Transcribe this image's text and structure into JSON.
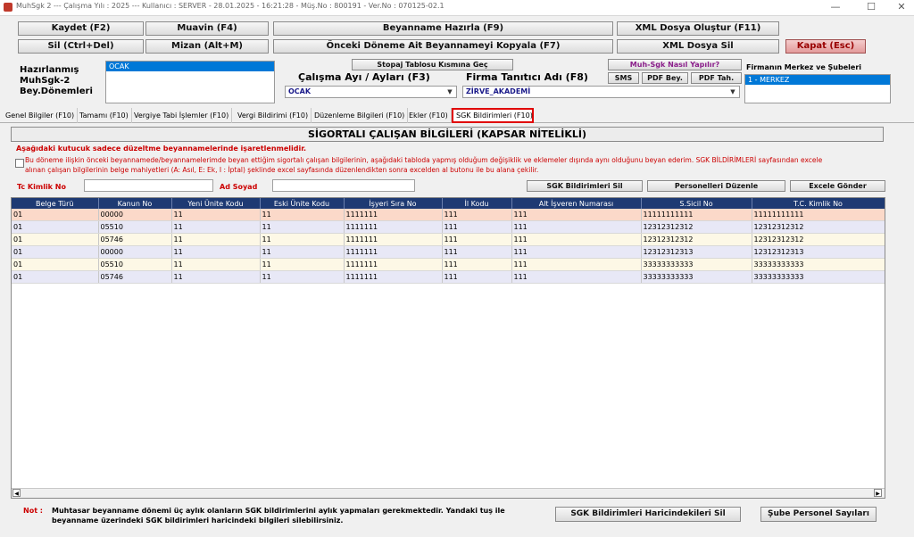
{
  "window": {
    "title": "MuhSgk 2  ---  Çalışma Yılı : 2025  ---  Kullanıcı : SERVER  -  28.01.2025  -  16:21:28  -  Müş.No : 800191  -  Ver.No : 070125-02.1",
    "minimize": "—",
    "maximize": "☐",
    "close": "✕"
  },
  "toolbar": {
    "kaydet": "Kaydet (F2)",
    "muavin": "Muavin (F4)",
    "beyanname_hazirla": "Beyanname Hazırla (F9)",
    "xml_olustur": "XML Dosya Oluştur (F11)",
    "sil": "Sil (Ctrl+Del)",
    "mizan": "Mizan (Alt+M)",
    "onceki_kopyala": "Önceki Döneme Ait Beyannameyi Kopyala (F7)",
    "xml_sil": "XML Dosya Sil",
    "kapat": "Kapat (Esc)"
  },
  "left_labels": [
    "Hazırlanmış",
    "MuhSgk-2",
    "Bey.Dönemleri"
  ],
  "donemler_list": [
    "OCAK"
  ],
  "stopaj_button": "Stopaj Tablosu Kısmına Geç",
  "calisma_label": "Çalışma Ayı / Ayları (F3)",
  "calisma_value": "OCAK",
  "firma_label": "Firma Tanıtıcı Adı (F8)",
  "firma_value": "ZİRVE_AKADEMİ",
  "nasil_button": "Muh-Sgk Nasıl Yapılır?",
  "sms_button": "SMS",
  "pdf_bey_button": "PDF Bey.",
  "pdf_tah_button": "PDF Tah.",
  "subeler_label": "Firmanın Merkez ve Şubeleri",
  "subeler_list": [
    "1 - MERKEZ"
  ],
  "tabs": [
    "Genel Bilgiler (F10)",
    "Tamamı (F10)",
    "Vergiye Tabi İşlemler (F10)",
    "Vergi Bildirimi (F10)",
    "Düzenleme Bilgileri (F10)",
    "Ekler (F10)",
    "SGK Bildirimleri (F10)"
  ],
  "section_title": "SİGORTALI ÇALIŞAN BİLGİLERİ (KAPSAR NİTELİKLİ)",
  "warning_heading": "Aşağıdaki kutucuk sadece düzeltme beyannamelerinde işaretlenmelidir.",
  "warning_line1": "Bu döneme ilişkin önceki beyannamede/beyannamelerimde beyan ettiğim sigortalı çalışan bilgilerinin, aşağıdaki tabloda yapmış olduğum değişiklik ve eklemeler dışında aynı olduğunu beyan ederim. SGK BİLDİRİMLERİ sayfasından excele",
  "warning_line2": "alınan çalışan bilgilerinin belge mahiyetleri (A: Asıl, E: Ek, I : İptal) şeklinde excel sayfasında düzenlendikten sonra excelden al butonu ile bu alana çekilir.",
  "tc_label": "Tc Kimlik No",
  "ad_label": "Ad Soyad",
  "sgk_sil_button": "SGK Bildirimleri Sil",
  "personel_duzenle_button": "Personelleri Düzenle",
  "excele_gonder_button": "Excele Gönder",
  "table": {
    "headers": [
      "Belge Türü",
      "Kanun No",
      "Yeni Ünite Kodu",
      "Eski Ünite Kodu",
      "İşyeri Sıra No",
      "İl Kodu",
      "Alt İşveren Numarası",
      "S.Sicil No",
      "T.C. Kimlik No"
    ],
    "rows": [
      [
        "01",
        "00000",
        "11",
        "11",
        "1111111",
        "111",
        "111",
        "11111111111",
        "11111111111"
      ],
      [
        "01",
        "05510",
        "11",
        "11",
        "1111111",
        "111",
        "111",
        "12312312312",
        "12312312312"
      ],
      [
        "01",
        "05746",
        "11",
        "11",
        "1111111",
        "111",
        "111",
        "12312312312",
        "12312312312"
      ],
      [
        "01",
        "00000",
        "11",
        "11",
        "1111111",
        "111",
        "111",
        "12312312313",
        "12312312313"
      ],
      [
        "01",
        "05510",
        "11",
        "11",
        "1111111",
        "111",
        "111",
        "33333333333",
        "33333333333"
      ],
      [
        "01",
        "05746",
        "11",
        "11",
        "1111111",
        "111",
        "111",
        "33333333333",
        "33333333333"
      ]
    ]
  },
  "note_label": "Not :",
  "note_line1": "Muhtasar beyanname dönemi üç aylık olanların SGK bildirimlerini aylık yapmaları gerekmektedir. Yandaki tuş ile",
  "note_line2": "beyanname üzerindeki SGK bildirimleri haricindeki bilgileri silebilirsiniz.",
  "haric_sil_button": "SGK Bildirimleri Haricindekileri Sil",
  "sube_personel_button": "Şube Personel Sayıları",
  "colors": {
    "header_bg": "#1e3a73",
    "highlight_row": "#fbd9c9",
    "accent_red": "#cc0000",
    "select_blue": "#0078d7"
  }
}
